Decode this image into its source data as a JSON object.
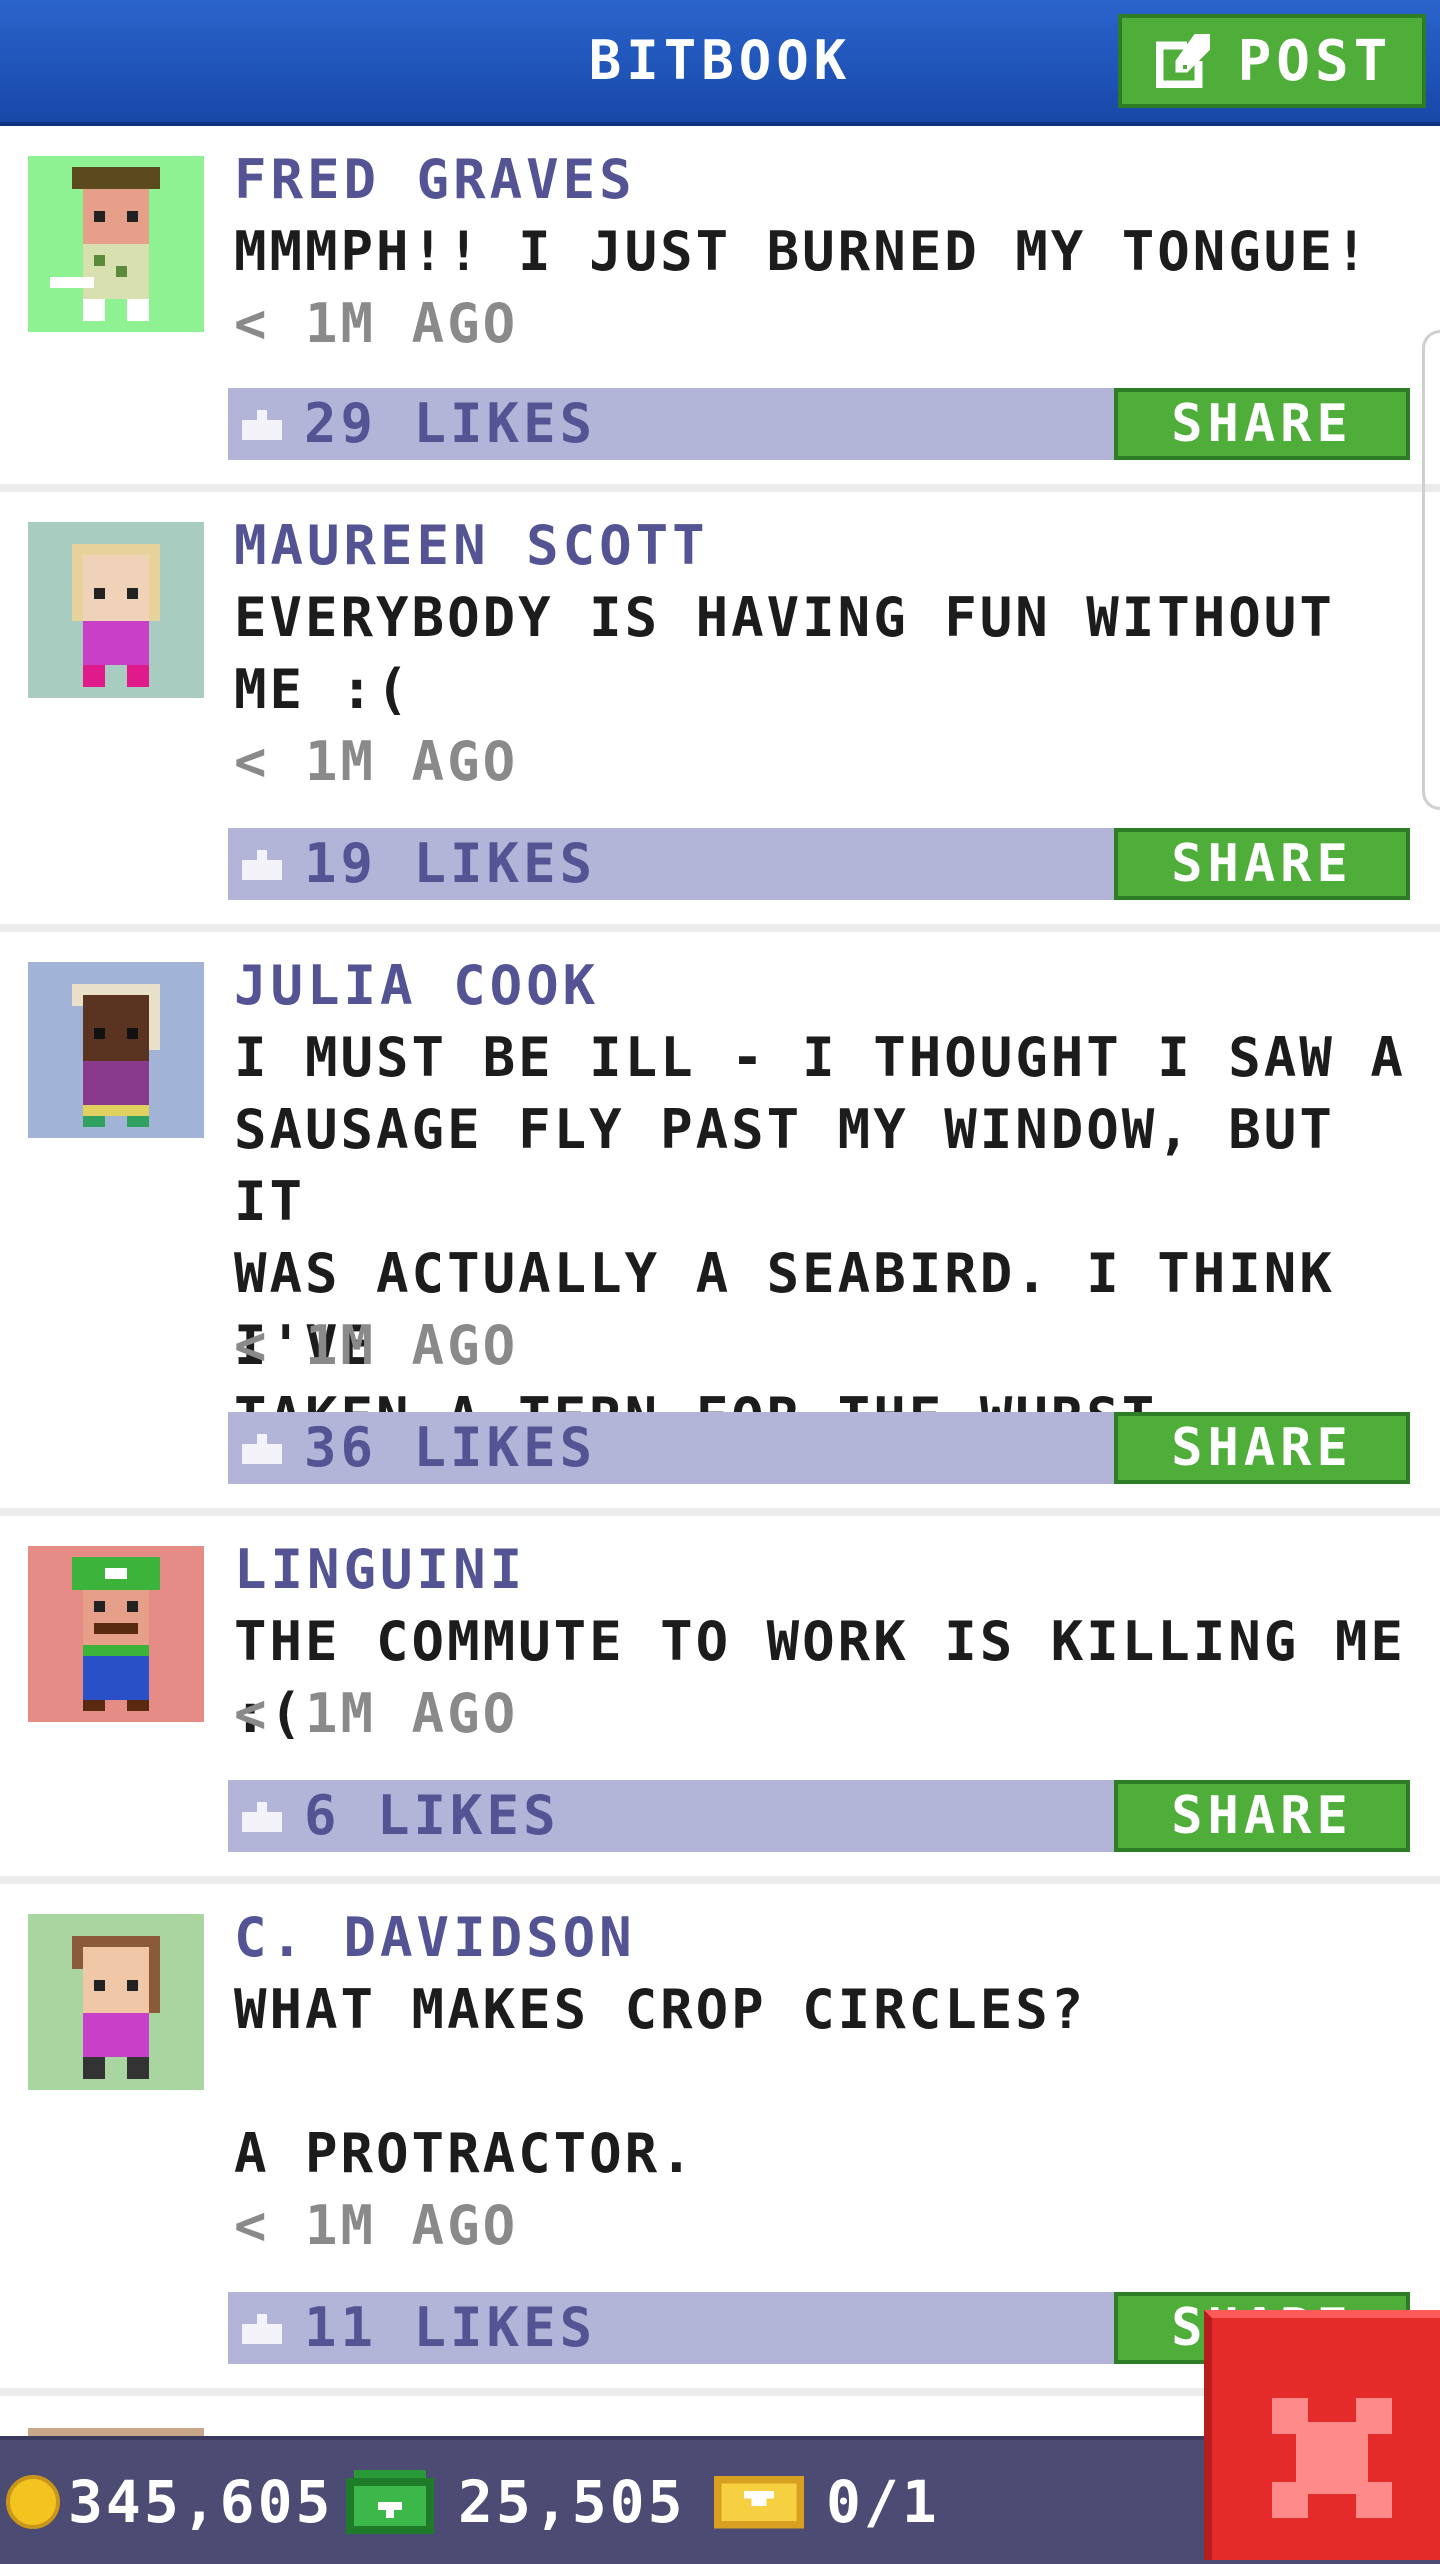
{
  "header": {
    "title": "BITBOOK",
    "post_label": "POST"
  },
  "posts": [
    {
      "author": "FRED GRAVES",
      "message": "MMMPH!! I JUST BURNED MY TONGUE!",
      "time": "< 1M AGO",
      "likes": "29 LIKES",
      "share_label": "SHARE",
      "avatar_bg": "#8ef293"
    },
    {
      "author": "MAUREEN SCOTT",
      "message": "EVERYBODY IS HAVING FUN WITHOUT\nME :(",
      "time": "< 1M AGO",
      "likes": "19 LIKES",
      "share_label": "SHARE",
      "avatar_bg": "#a9ccc1"
    },
    {
      "author": "JULIA COOK",
      "message": "I MUST BE ILL - I THOUGHT I SAW A\nSAUSAGE FLY PAST MY WINDOW, BUT IT\nWAS ACTUALLY A SEABIRD. I THINK I'VE\nTAKEN A TERN FOR THE WURST.",
      "time": "< 1M AGO",
      "likes": "36 LIKES",
      "share_label": "SHARE",
      "avatar_bg": "#a2b3d8"
    },
    {
      "author": "LINGUINI",
      "message": "THE COMMUTE TO WORK IS KILLING ME :(",
      "time": "< 1M AGO",
      "likes": "6 LIKES",
      "share_label": "SHARE",
      "avatar_bg": "#e58c86"
    },
    {
      "author": "C. DAVIDSON",
      "message": "WHAT MAKES CROP CIRCLES?\n\nA PROTRACTOR.",
      "time": "< 1M AGO",
      "likes": "11 LIKES",
      "share_label": "SHARE",
      "avatar_bg": "#a8d5a0"
    }
  ],
  "bottombar": {
    "coins": "345,605",
    "bux": "25,505",
    "tickets": "0/1"
  },
  "colors": {
    "header_blue": "#1f55b8",
    "share_green": "#4fad3a",
    "likes_bar": "#b2b4d8",
    "author_purple": "#545494",
    "close_red": "#e52a2a"
  },
  "icons": [
    "post-edit-icon",
    "like-icon",
    "coin-icon",
    "bux-icon",
    "ticket-icon",
    "close-icon"
  ]
}
